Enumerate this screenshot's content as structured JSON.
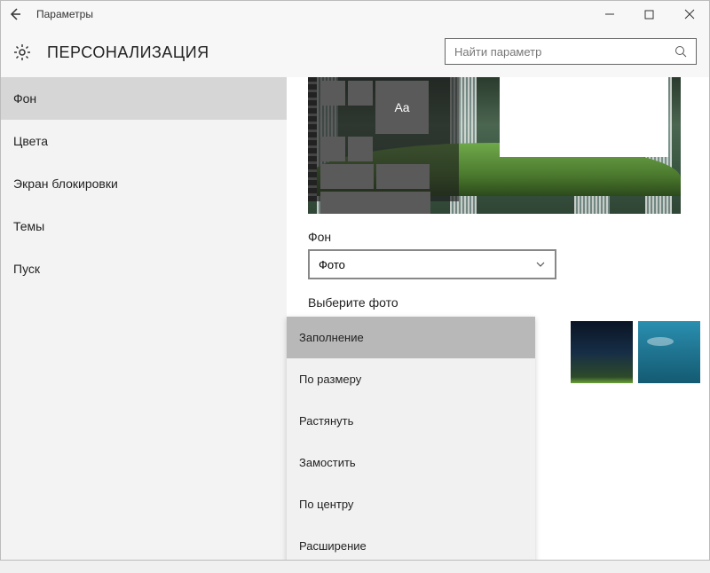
{
  "titlebar": {
    "title": "Параметры"
  },
  "header": {
    "page_title": "ПЕРСОНАЛИЗАЦИЯ"
  },
  "search": {
    "placeholder": "Найти параметр"
  },
  "sidebar": {
    "items": [
      {
        "label": "Фон",
        "selected": true
      },
      {
        "label": "Цвета",
        "selected": false
      },
      {
        "label": "Экран блокировки",
        "selected": false
      },
      {
        "label": "Темы",
        "selected": false
      },
      {
        "label": "Пуск",
        "selected": false
      }
    ]
  },
  "content": {
    "preview_sample_text": "Aa",
    "bg_label": "Фон",
    "bg_combo_value": "Фото",
    "choose_label": "Выберите фото",
    "fit_options": [
      {
        "label": "Заполнение",
        "selected": true
      },
      {
        "label": "По размеру",
        "selected": false
      },
      {
        "label": "Растянуть",
        "selected": false
      },
      {
        "label": "Замостить",
        "selected": false
      },
      {
        "label": "По центру",
        "selected": false
      },
      {
        "label": "Расширение",
        "selected": false
      }
    ]
  }
}
